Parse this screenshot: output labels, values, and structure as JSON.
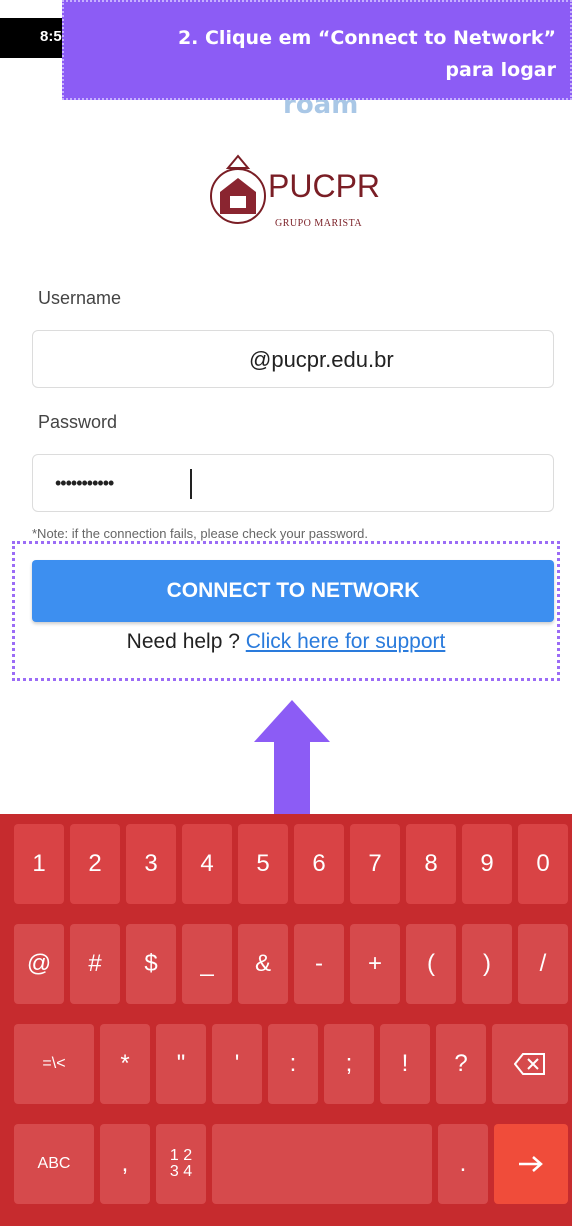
{
  "status_bar": {
    "time": "8:5"
  },
  "callout": {
    "line1": "2. Clique em “Connect to Network”",
    "line2": "para logar"
  },
  "brand": {
    "eduroam": "roam",
    "logo_text": "PUCPR",
    "logo_sub": "GRUPO MARISTA"
  },
  "form": {
    "username_label": "Username",
    "username_value": "@pucpr.edu.br",
    "password_label": "Password",
    "password_value": "•••••••••••",
    "note": "*Note: if the connection fails, please check your password.",
    "connect_label": "CONNECT TO NETWORK",
    "help_text": "Need help ? ",
    "help_link": "Click here for support"
  },
  "colors": {
    "callout": "#8c5cf5",
    "connect": "#3d8ff0",
    "keyboard": "#c62b2e",
    "enter": "#f04c3a"
  },
  "keyboard": {
    "row1": [
      "1",
      "2",
      "3",
      "4",
      "5",
      "6",
      "7",
      "8",
      "9",
      "0"
    ],
    "row2": [
      "@",
      "#",
      "$",
      "_",
      "&",
      "-",
      "+",
      "(",
      ")",
      "/"
    ],
    "row3": [
      "=\\<",
      "*",
      "\"",
      "'",
      ":",
      ";",
      "!",
      "?"
    ],
    "backspace_icon": "backspace-icon",
    "abc": "ABC",
    "comma": ",",
    "num_switch": "1 2\n3 4",
    "period": ".",
    "enter_icon": "arrow-right-icon"
  }
}
